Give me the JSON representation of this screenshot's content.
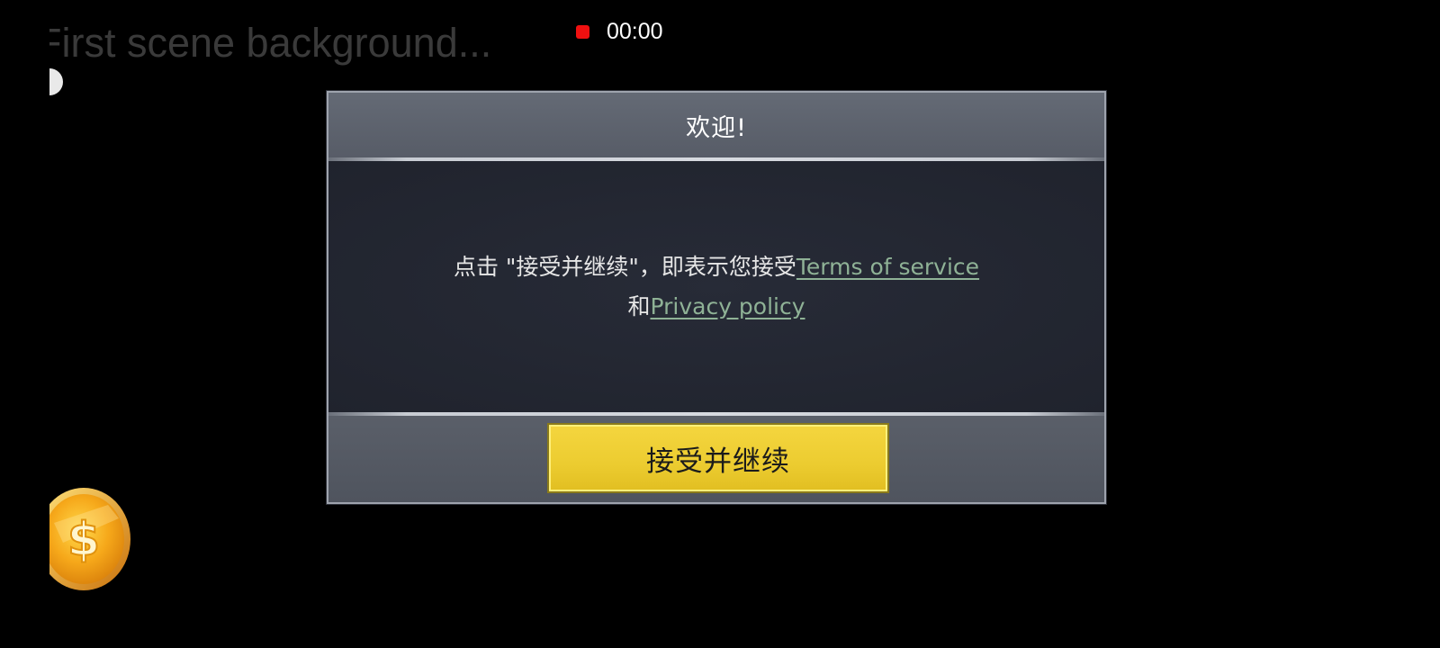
{
  "status": {
    "loading_text": "First scene background...",
    "recording_time": "00:00"
  },
  "dialog": {
    "title": "欢迎!",
    "message_prefix": "点击 \"接受并继续\"，即表示您接受",
    "terms_link": "Terms of service",
    "conjunction": "和",
    "privacy_link": "Privacy policy",
    "accept_button": "接受并继续"
  },
  "icons": {
    "record": "record-dot-icon",
    "moon": "half-moon-icon",
    "coin": "dollar-coin-icon"
  },
  "colors": {
    "accent_yellow": "#f2d23a",
    "link_green": "#8fb296",
    "record_red": "#f01010"
  }
}
